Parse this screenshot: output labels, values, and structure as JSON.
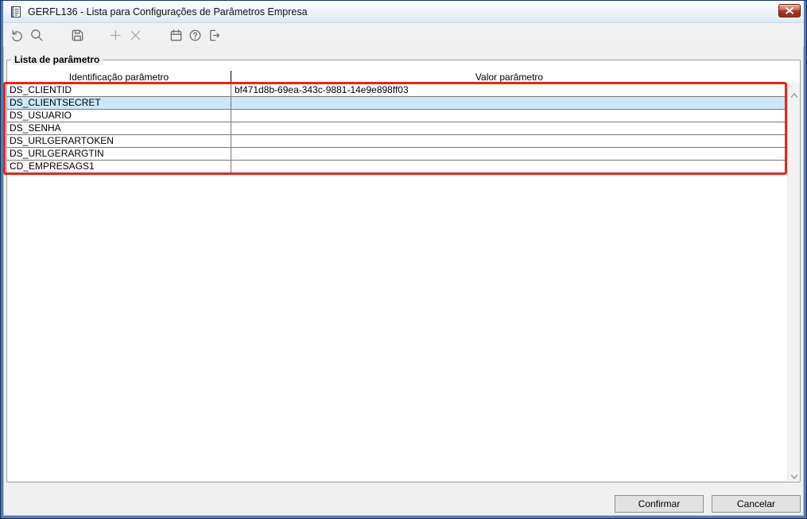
{
  "window": {
    "title": "GERFL136 - Lista para Configurações de Parâmetros Empresa",
    "icon": "document-icon",
    "close": "close-icon"
  },
  "toolbar": {
    "icons": [
      {
        "name": "undo-icon",
        "enabled": true
      },
      {
        "name": "search-icon",
        "enabled": true
      },
      {
        "name": "save-icon",
        "enabled": true
      },
      {
        "name": "add-icon",
        "enabled": false
      },
      {
        "name": "delete-icon",
        "enabled": false
      },
      {
        "name": "calendar-icon",
        "enabled": true
      },
      {
        "name": "help-icon",
        "enabled": true
      },
      {
        "name": "exit-icon",
        "enabled": true
      }
    ]
  },
  "group": {
    "label": "Lista de parâmetro"
  },
  "table": {
    "headers": {
      "id": "Identificação parâmetro",
      "value": "Valor parâmetro"
    },
    "rows": [
      {
        "id": "DS_CLIENTID",
        "value": "bf471d8b-69ea-343c-9881-14e9e898ff03",
        "selected": false
      },
      {
        "id": "DS_CLIENTSECRET",
        "value": "",
        "selected": true
      },
      {
        "id": "DS_USUARIO",
        "value": "",
        "selected": false
      },
      {
        "id": "DS_SENHA",
        "value": "",
        "selected": false
      },
      {
        "id": "DS_URLGERARTOKEN",
        "value": "",
        "selected": false
      },
      {
        "id": "DS_URLGERARGTIN",
        "value": "",
        "selected": false
      },
      {
        "id": "CD_EMPRESAGS1",
        "value": "",
        "selected": false
      }
    ]
  },
  "scrollbar": {
    "up": "chevron-up-icon",
    "down": "chevron-down-icon"
  },
  "footer": {
    "confirm": "Confirmar",
    "cancel": "Cancelar"
  },
  "colors": {
    "selection": "#cbe8fa",
    "annotation": "#e8241c",
    "frame_outer": "#16335c",
    "frame_inner": "#527cae",
    "close_button_red": "#b23626",
    "form_background": "#f0f0f0"
  }
}
